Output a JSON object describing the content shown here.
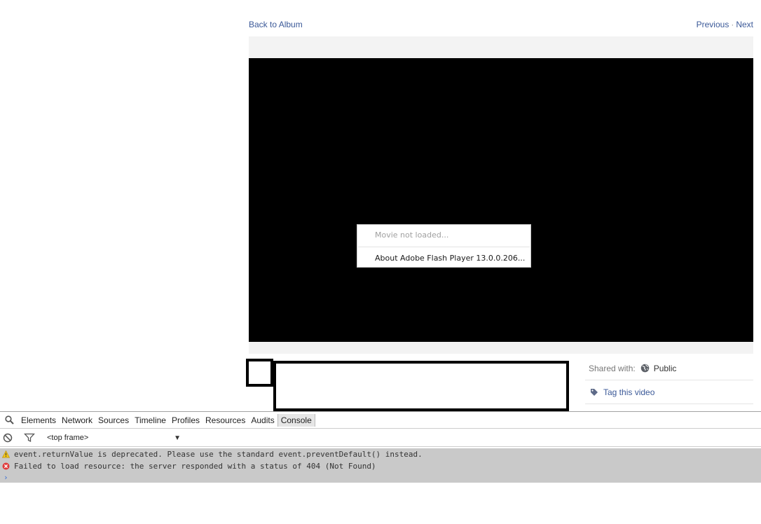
{
  "page": {
    "back_link": "Back to Album",
    "previous_label": "Previous",
    "pager_separator": "·",
    "next_label": "Next"
  },
  "flash_menu": {
    "movie_status": "Movie not loaded...",
    "about": "About Adobe Flash Player 13.0.0.206..."
  },
  "sidebar": {
    "shared_label": "Shared with:",
    "shared_icon": "globe-icon",
    "privacy": "Public",
    "tag_icon": "tag-icon",
    "tag_label": "Tag this video"
  },
  "devtools": {
    "tabs": [
      "Elements",
      "Network",
      "Sources",
      "Timeline",
      "Profiles",
      "Resources",
      "Audits",
      "Console"
    ],
    "active_tab": "Console",
    "frame_selector": "<top frame>",
    "messages": [
      {
        "level": "warning",
        "icon": "warning-icon",
        "text": "event.returnValue is deprecated. Please use the standard event.preventDefault() instead."
      },
      {
        "level": "error",
        "icon": "error-icon",
        "text": "Failed to load resource: the server responded with a status of 404 (Not Found)"
      }
    ],
    "prompt_icon": "prompt-chevron-icon"
  },
  "colors": {
    "link": "#3b5998",
    "player_bg": "#000000",
    "console_bg": "#c9c9c9",
    "warning": "#f0c419",
    "error": "#e03c3c"
  }
}
